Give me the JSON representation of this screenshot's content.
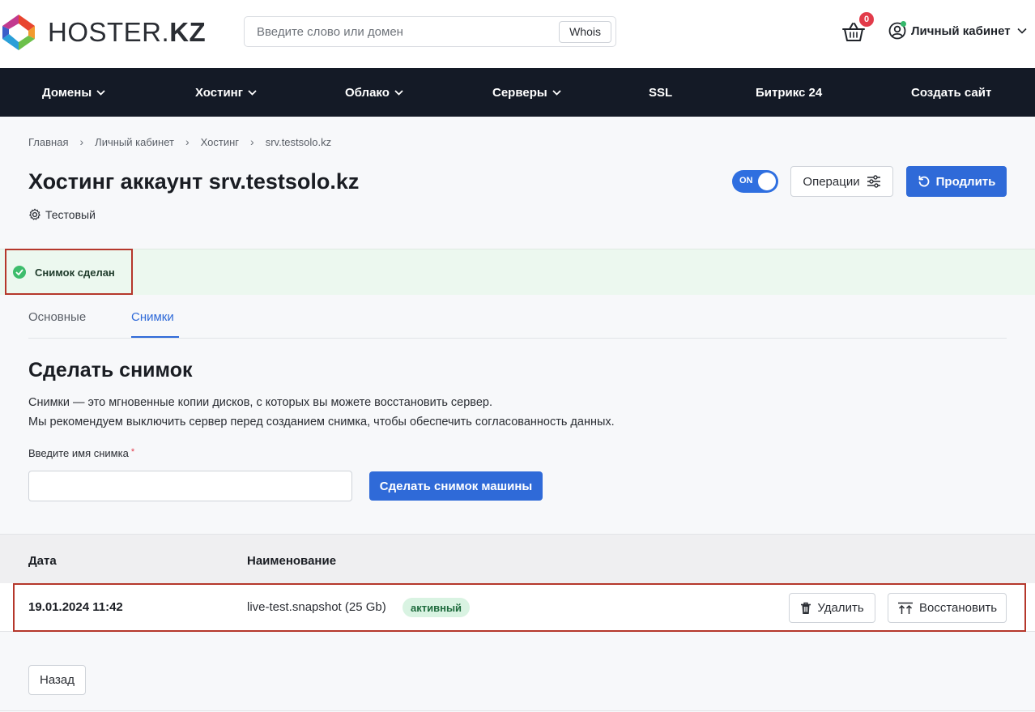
{
  "header": {
    "logo_text_light": "HOSTER.",
    "logo_text_bold": "KZ",
    "search_placeholder": "Введите слово или домен",
    "whois_label": "Whois",
    "cart_count": "0",
    "account_label": "Личный кабинет",
    "account_status_color": "#35b86b"
  },
  "nav": {
    "items": [
      {
        "label": "Домены",
        "has_dropdown": true
      },
      {
        "label": "Хостинг",
        "has_dropdown": true
      },
      {
        "label": "Облако",
        "has_dropdown": true
      },
      {
        "label": "Серверы",
        "has_dropdown": true
      },
      {
        "label": "SSL",
        "has_dropdown": false
      },
      {
        "label": "Битрикс 24",
        "has_dropdown": false
      },
      {
        "label": "Создать сайт",
        "has_dropdown": false
      }
    ]
  },
  "breadcrumb": [
    "Главная",
    "Личный кабинет",
    "Хостинг",
    "srv.testsolo.kz"
  ],
  "page": {
    "title": "Хостинг аккаунт srv.testsolo.kz",
    "subtitle": "Тестовый",
    "toggle_label": "ON",
    "operations_label": "Операции",
    "renew_label": "Продлить"
  },
  "alert": {
    "message": "Снимок сделан",
    "type": "success"
  },
  "tabs": [
    {
      "label": "Основные",
      "active": false
    },
    {
      "label": "Снимки",
      "active": true
    }
  ],
  "snapshot_form": {
    "title": "Сделать снимок",
    "description_1": "Снимки — это мгновенные копии дисков, с которых вы можете восстановить сервер.",
    "description_2": "Мы рекомендуем выключить сервер перед созданием снимка, чтобы обеспечить согласованность данных.",
    "name_label": "Введите имя снимка",
    "required_mark": "*",
    "name_value": "",
    "submit_label": "Сделать снимок машины"
  },
  "snapshots_table": {
    "columns": [
      "Дата",
      "Наименование"
    ],
    "rows": [
      {
        "date": "19.01.2024 11:42",
        "name": "live-test.snapshot (25 Gb)",
        "status": "активный",
        "delete_label": "Удалить",
        "restore_label": "Восстановить"
      }
    ]
  },
  "back_label": "Назад",
  "colors": {
    "accent": "#2f6ad8",
    "navbar": "#141a26",
    "success_bg": "#ecf8ef",
    "badge_bg": "#d9f3e2",
    "highlight": "#b5372b",
    "cart_badge": "#e23b4a"
  }
}
